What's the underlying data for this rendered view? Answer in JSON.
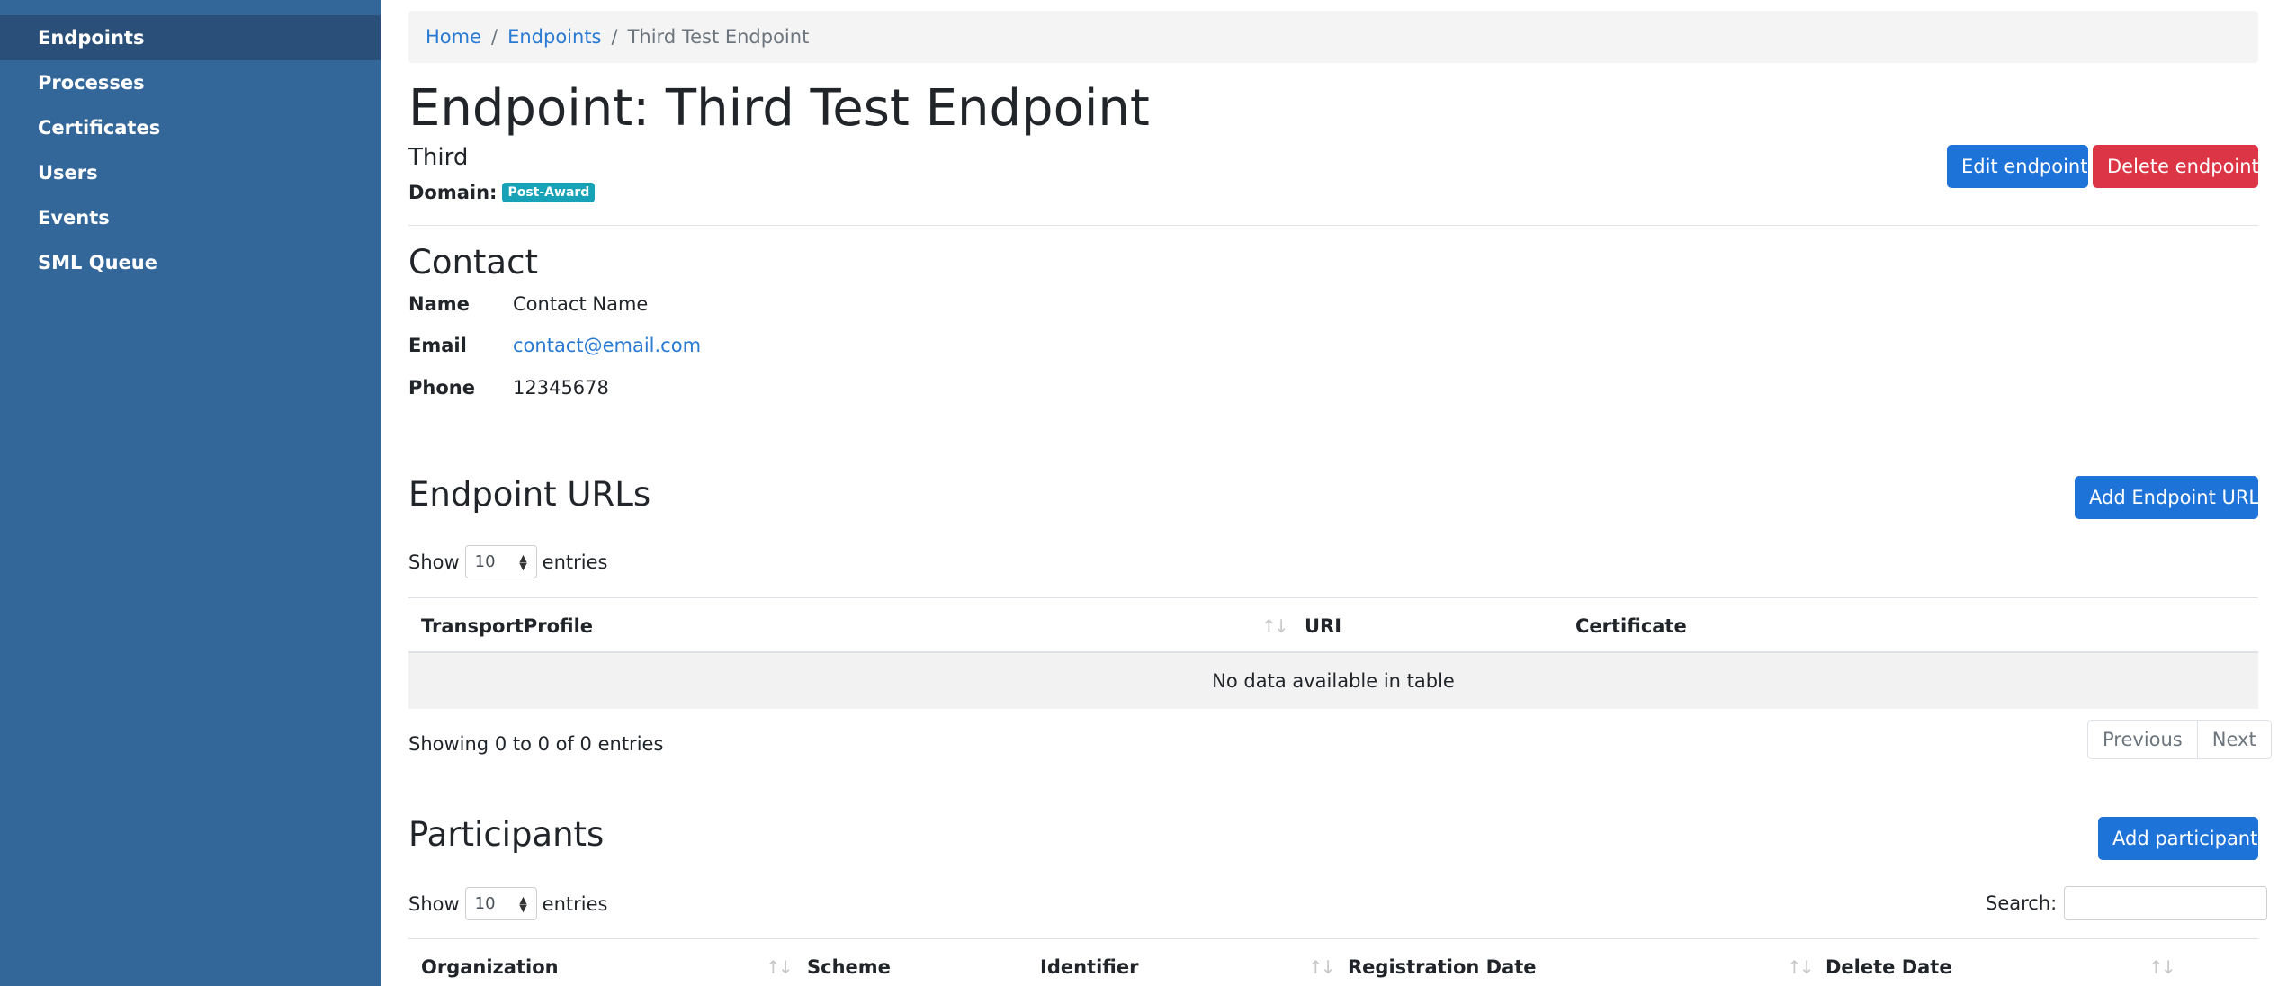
{
  "sidebar": {
    "items": [
      {
        "label": "Endpoints"
      },
      {
        "label": "Processes"
      },
      {
        "label": "Certificates"
      },
      {
        "label": "Users"
      },
      {
        "label": "Events"
      },
      {
        "label": "SML Queue"
      }
    ]
  },
  "breadcrumb": {
    "home": "Home",
    "endpoints": "Endpoints",
    "current": "Third Test Endpoint",
    "separator": "/"
  },
  "header": {
    "title": "Endpoint: Third Test Endpoint",
    "subtitle": "Third",
    "domain_label": "Domain:",
    "domain_badge": "Post-Award",
    "edit_button": "Edit endpoint",
    "delete_button": "Delete endpoint"
  },
  "contact": {
    "title": "Contact",
    "name_label": "Name",
    "name_value": "Contact Name",
    "email_label": "Email",
    "email_value": "contact@email.com",
    "phone_label": "Phone",
    "phone_value": "12345678"
  },
  "endpoint_urls": {
    "title": "Endpoint URLs",
    "add_button": "Add Endpoint URL",
    "show_label": "Show",
    "page_size": "10",
    "entries_label": "entries",
    "columns": [
      "TransportProfile",
      "URI",
      "Certificate"
    ],
    "empty_message": "No data available in table",
    "info": "Showing 0 to 0 of 0 entries",
    "previous": "Previous",
    "next": "Next"
  },
  "participants": {
    "title": "Participants",
    "add_button": "Add participant",
    "show_label": "Show",
    "page_size": "10",
    "entries_label": "entries",
    "search_label": "Search:",
    "columns": [
      "Organization",
      "Scheme",
      "Identifier",
      "Registration Date",
      "Delete Date"
    ]
  },
  "colors": {
    "sidebar": "#336699",
    "sidebar_active": "#2a4f79",
    "primary": "#1e73d9",
    "danger": "#dc3545",
    "badge": "#17a2b8",
    "link": "#2a7ad2"
  }
}
